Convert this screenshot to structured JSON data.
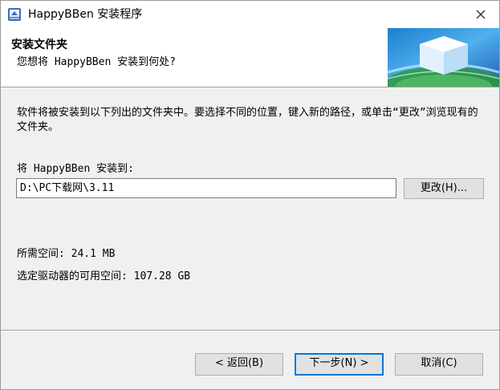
{
  "window": {
    "title": "HappyBBen 安装程序",
    "close_glyph": "✕"
  },
  "header": {
    "title": "安装文件夹",
    "subtitle": "您想将 HappyBBen 安装到何处?"
  },
  "content": {
    "description": "软件将被安装到以下列出的文件夹中。要选择不同的位置，键入新的路径，或单击“更改”浏览现有的文件夹。",
    "install_to_label": "将 HappyBBen 安装到:",
    "install_path": "D:\\PC下载网\\3.11",
    "change_button": "更改(H)...",
    "space_required": "所需空间: 24.1 MB",
    "space_available": "选定驱动器的可用空间: 107.28 GB"
  },
  "footer": {
    "back_button": "< 返回(B)",
    "next_button": "下一步(N) >",
    "cancel_button": "取消(C)"
  },
  "colors": {
    "default_button_border": "#0078d7",
    "button_face": "#e1e1e1",
    "dialog_background": "#f0f0f0"
  }
}
